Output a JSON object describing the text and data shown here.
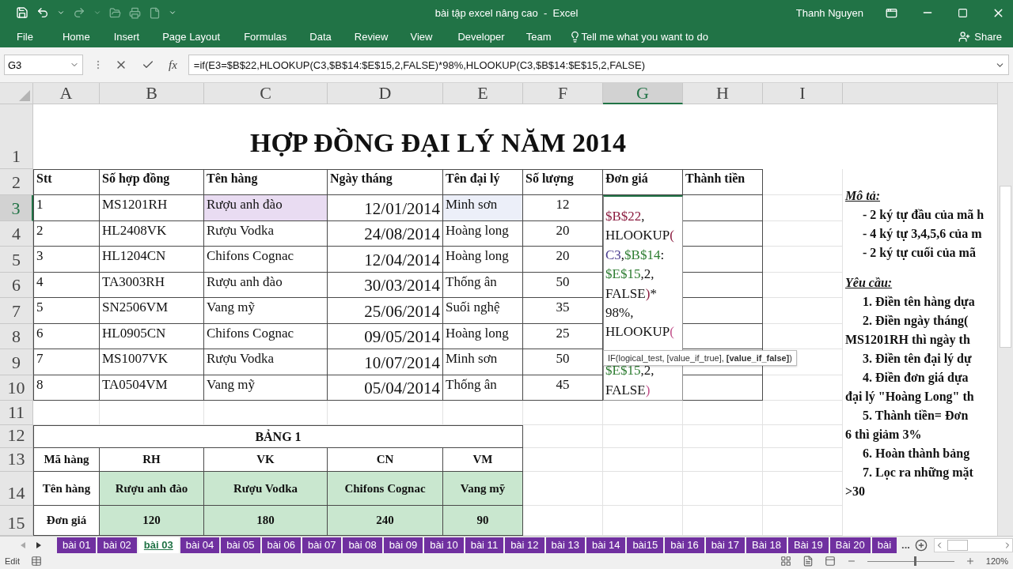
{
  "window": {
    "title": "bài tập excel nâng cao  -  Excel",
    "user": "Thanh Nguyen"
  },
  "ribbon_tabs": [
    "File",
    "Home",
    "Insert",
    "Page Layout",
    "Formulas",
    "Data",
    "Review",
    "View",
    "Developer",
    "Team"
  ],
  "tell_me": "Tell me what you want to do",
  "share": "Share",
  "formula_bar": {
    "name_box": "G3",
    "function_label": "fx",
    "formula": "=if(E3=$B$22,HLOOKUP(C3,$B$14:$E$15,2,FALSE)*98%,HLOOKUP(C3,$B$14:$E$15,2,FALSE)"
  },
  "columns": [
    {
      "label": "A",
      "selected": false
    },
    {
      "label": "B",
      "selected": false
    },
    {
      "label": "C",
      "selected": false
    },
    {
      "label": "D",
      "selected": false
    },
    {
      "label": "E",
      "selected": false
    },
    {
      "label": "F",
      "selected": false
    },
    {
      "label": "G",
      "selected": true
    },
    {
      "label": "H",
      "selected": false
    },
    {
      "label": "I",
      "selected": false
    }
  ],
  "row_numbers": [
    {
      "label": "1",
      "selected": false
    },
    {
      "label": "2",
      "selected": false
    },
    {
      "label": "3",
      "selected": true
    },
    {
      "label": "4",
      "selected": false
    },
    {
      "label": "5",
      "selected": false
    },
    {
      "label": "6",
      "selected": false
    },
    {
      "label": "7",
      "selected": false
    },
    {
      "label": "8",
      "selected": false
    },
    {
      "label": "9",
      "selected": false
    },
    {
      "label": "10",
      "selected": false
    },
    {
      "label": "11",
      "selected": false
    },
    {
      "label": "12",
      "selected": false
    },
    {
      "label": "13",
      "selected": false
    },
    {
      "label": "14",
      "selected": false
    },
    {
      "label": "15",
      "selected": false
    }
  ],
  "sheet": {
    "title": "HỢP ĐỒNG ĐẠI LÝ NĂM 2014",
    "contract_table": {
      "headers": [
        "Stt",
        "Số hợp đồng",
        "Tên hàng",
        "Ngày tháng",
        "Tên đại lý",
        "Số lượng",
        "Đơn giá",
        "Thành tiền"
      ],
      "rows": [
        {
          "cells": [
            {
              "text": "1"
            },
            {
              "text": "MS1201RH"
            },
            {
              "text": "Rượu anh đào",
              "color": "#e9dcf2"
            },
            {
              "text": "12/01/2014"
            },
            {
              "text": "Minh sơn",
              "color": "#eceff9"
            },
            {
              "text": "12"
            }
          ]
        },
        {
          "cells": [
            {
              "text": "2"
            },
            {
              "text": "HL2408VK"
            },
            {
              "text": "Rượu Vodka"
            },
            {
              "text": "24/08/2014"
            },
            {
              "text": "Hoàng long"
            },
            {
              "text": "20"
            }
          ]
        },
        {
          "cells": [
            {
              "text": "3"
            },
            {
              "text": "HL1204CN"
            },
            {
              "text": "Chifons Cognac"
            },
            {
              "text": "12/04/2014"
            },
            {
              "text": "Hoàng long"
            },
            {
              "text": "20"
            }
          ]
        },
        {
          "cells": [
            {
              "text": "4"
            },
            {
              "text": "TA3003RH"
            },
            {
              "text": "Rượu anh đào"
            },
            {
              "text": "30/03/2014"
            },
            {
              "text": "Thống ân"
            },
            {
              "text": "50"
            }
          ]
        },
        {
          "cells": [
            {
              "text": "5"
            },
            {
              "text": "SN2506VM"
            },
            {
              "text": "Vang mỹ"
            },
            {
              "text": "25/06/2014"
            },
            {
              "text": "Suối nghệ"
            },
            {
              "text": "35"
            }
          ]
        },
        {
          "cells": [
            {
              "text": "6"
            },
            {
              "text": "HL0905CN"
            },
            {
              "text": "Chifons Cognac"
            },
            {
              "text": "09/05/2014"
            },
            {
              "text": "Hoàng long"
            },
            {
              "text": "25"
            }
          ]
        },
        {
          "cells": [
            {
              "text": "7"
            },
            {
              "text": "MS1007VK"
            },
            {
              "text": "Rượu Vodka"
            },
            {
              "text": "10/07/2014"
            },
            {
              "text": "Minh sơn"
            },
            {
              "text": "50"
            }
          ]
        },
        {
          "cells": [
            {
              "text": "8"
            },
            {
              "text": "TA0504VM"
            },
            {
              "text": "Vang mỹ"
            },
            {
              "text": "05/04/2014"
            },
            {
              "text": "Thống ân"
            },
            {
              "text": "45"
            }
          ]
        }
      ]
    },
    "cell_editor": {
      "lines": [
        {
          "segments": [
            {
              "text": "$B$22",
              "kind": "refa"
            },
            {
              "text": ",",
              "kind": "plain"
            }
          ]
        },
        {
          "segments": [
            {
              "text": "HLOOKUP",
              "kind": "plain"
            },
            {
              "text": "(",
              "kind": "parena"
            }
          ]
        },
        {
          "segments": [
            {
              "text": "C3",
              "kind": "refb"
            },
            {
              "text": ",",
              "kind": "plain"
            },
            {
              "text": "$B$14",
              "kind": "refc"
            },
            {
              "text": ":",
              "kind": "plain"
            }
          ]
        },
        {
          "segments": [
            {
              "text": "$E$15",
              "kind": "refc"
            },
            {
              "text": ",2,",
              "kind": "plain"
            }
          ]
        },
        {
          "segments": [
            {
              "text": "FALSE",
              "kind": "plain"
            },
            {
              "text": ")",
              "kind": "parena"
            },
            {
              "text": "*",
              "kind": "plain"
            }
          ]
        },
        {
          "segments": [
            {
              "text": "98%,",
              "kind": "plain"
            }
          ]
        },
        {
          "segments": [
            {
              "text": "HLOOKUP",
              "kind": "plain"
            },
            {
              "text": "(",
              "kind": "parenb"
            }
          ]
        },
        {
          "gap_before": true,
          "segments": [
            {
              "text": "$E$15",
              "kind": "refc"
            },
            {
              "text": ",2,",
              "kind": "plain"
            }
          ]
        },
        {
          "segments": [
            {
              "text": "FALSE",
              "kind": "plain"
            },
            {
              "text": ")",
              "kind": "parenb"
            }
          ]
        }
      ],
      "tooltip": "IF(logical_test, [value_if_true], **[value_if_false]**)"
    },
    "table_1": {
      "title": "BẢNG 1",
      "rows": [
        {
          "label": "Mã hàng",
          "filled": false,
          "values": [
            "RH",
            "VK",
            "CN",
            "VM"
          ]
        },
        {
          "label": "Tên hàng",
          "filled": true,
          "values": [
            "Rượu anh đào",
            "Rượu Vodka",
            "Chifons Cognac",
            "Vang mỹ"
          ]
        },
        {
          "label": "Đơn giá",
          "filled": true,
          "values": [
            "120",
            "180",
            "240",
            "90"
          ]
        }
      ]
    }
  },
  "notes": [
    {
      "kind": "heading",
      "text": "Mô tả:"
    },
    {
      "kind": "item",
      "text": "- 2 ký tự đầu của mã h"
    },
    {
      "kind": "item",
      "text": "- 4 ký tự 3,4,5,6 của m"
    },
    {
      "kind": "item",
      "text": "- 2 ký tự cuối của mã"
    },
    {
      "kind": "heading",
      "text": "Yêu cầu:"
    },
    {
      "kind": "item",
      "text": "1. Điền tên hàng dựa"
    },
    {
      "kind": "item",
      "text": "2. Điền ngày tháng("
    },
    {
      "kind": "cont",
      "text": "MS1201RH thì ngày th"
    },
    {
      "kind": "item",
      "text": "3. Điền tên đại lý dự"
    },
    {
      "kind": "item",
      "text": "4. Điền đơn giá dựa"
    },
    {
      "kind": "cont",
      "text": "đại lý \"Hoàng Long\" th"
    },
    {
      "kind": "item",
      "text": "5. Thành tiền= Đơn"
    },
    {
      "kind": "cont",
      "text": "6 thì giảm 3%"
    },
    {
      "kind": "item",
      "text": "6. Hoàn thành bảng"
    },
    {
      "kind": "item",
      "text": "7. Lọc ra những mặt"
    },
    {
      "kind": "cont",
      "text": ">30"
    }
  ],
  "sheet_tabs": [
    {
      "label": "bài 01",
      "selected": false
    },
    {
      "label": "bài 02",
      "selected": false
    },
    {
      "label": "bài 03",
      "selected": true
    },
    {
      "label": "bài 04",
      "selected": false
    },
    {
      "label": "bài 05",
      "selected": false
    },
    {
      "label": "bài 06",
      "selected": false
    },
    {
      "label": "bài 07",
      "selected": false
    },
    {
      "label": "bài 08",
      "selected": false
    },
    {
      "label": "bài 09",
      "selected": false
    },
    {
      "label": "bài 10",
      "selected": false
    },
    {
      "label": "bài 11",
      "selected": false
    },
    {
      "label": "bài 12",
      "selected": false
    },
    {
      "label": "bài 13",
      "selected": false
    },
    {
      "label": "bài 14",
      "selected": false
    },
    {
      "label": "bài15",
      "selected": false
    },
    {
      "label": "bài 16",
      "selected": false
    },
    {
      "label": "bài 17",
      "selected": false
    },
    {
      "label": "Bài 18",
      "selected": false
    },
    {
      "label": "Bài 19",
      "selected": false
    },
    {
      "label": "Bài 20",
      "selected": false
    },
    {
      "label": "bài",
      "selected": false
    }
  ],
  "more_tabs": "...",
  "status_bar": {
    "mode": "Edit",
    "zoom": "120%",
    "zoom_slider": {
      "level": 0.55
    }
  }
}
